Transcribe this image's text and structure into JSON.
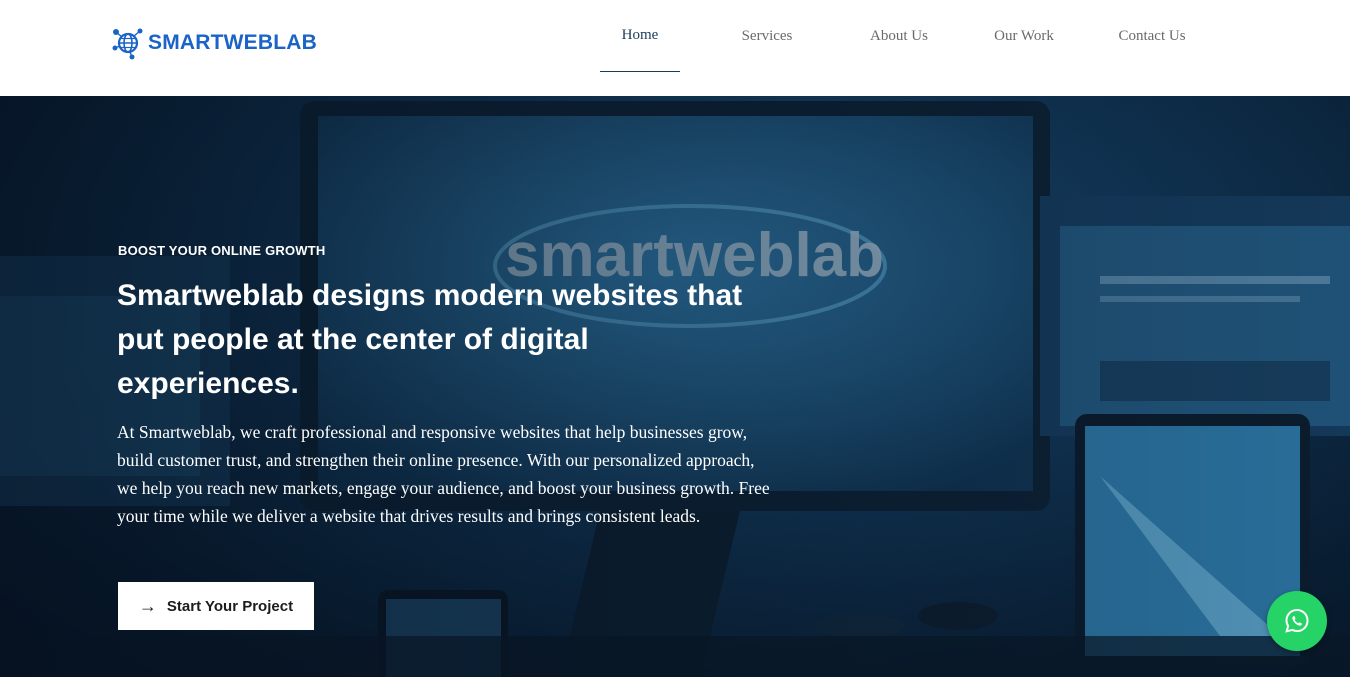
{
  "brand": {
    "name": "SMARTWEBLAB",
    "color": "#1a63c7"
  },
  "nav": {
    "items": [
      {
        "label": "Home",
        "active": true
      },
      {
        "label": "Services",
        "active": false
      },
      {
        "label": "About Us",
        "active": false
      },
      {
        "label": "Our Work",
        "active": false
      },
      {
        "label": "Contact Us",
        "active": false
      }
    ]
  },
  "hero": {
    "eyebrow": "BOOST YOUR ONLINE GROWTH",
    "headline": "Smartweblab designs modern websites that put people at the center of digital experiences.",
    "paragraph": "At Smartweblab, we craft professional and responsive websites that help businesses grow, build customer trust, and strengthen their online presence. With our personalized approach, we help you reach new markets, engage your audience, and boost your business growth. Free your time while we deliver a website that drives results and brings consistent leads.",
    "background_text": "smartweblab",
    "cta": {
      "label": "Start Your Project",
      "icon": "arrow-right-icon"
    }
  },
  "floating": {
    "whatsapp_icon": "whatsapp-icon",
    "color": "#25d366"
  }
}
